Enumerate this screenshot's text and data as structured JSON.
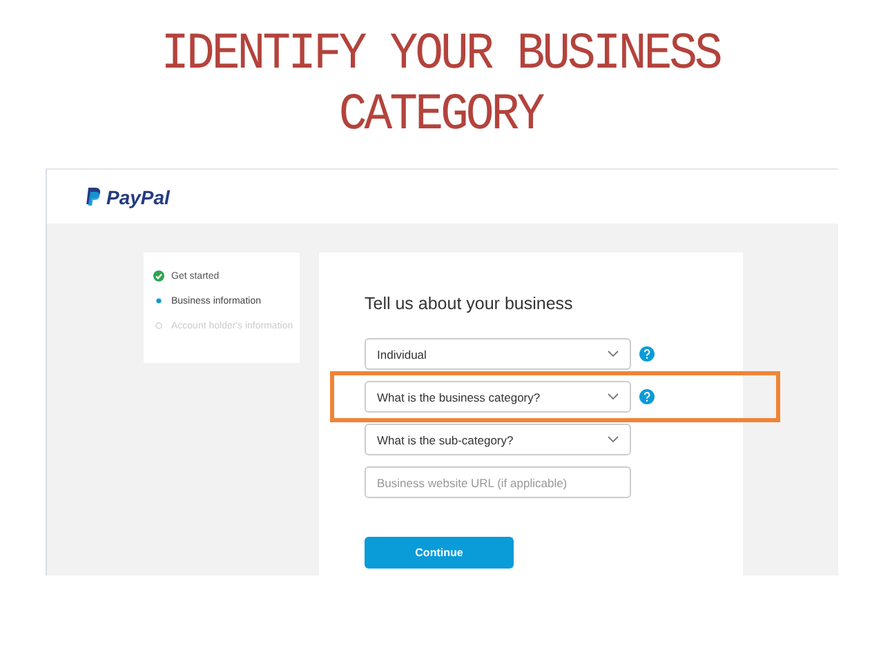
{
  "slide_title": [
    "IDENTIFY YOUR BUSINESS",
    "CATEGORY"
  ],
  "header": {
    "logo_text": "PayPal"
  },
  "steps": [
    {
      "label": "Get started",
      "completed": true,
      "current": false
    },
    {
      "label": "Business information",
      "completed": false,
      "current": true
    },
    {
      "label": "Account holder's information",
      "completed": false,
      "current": false
    }
  ],
  "form": {
    "heading": "Tell us about your business",
    "fields": [
      {
        "kind": "select",
        "value": "Individual",
        "help": true,
        "highlighted": false
      },
      {
        "kind": "select",
        "value": "What is the business category?",
        "help": true,
        "highlighted": true
      },
      {
        "kind": "select",
        "value": "What is the sub-category?",
        "help": false,
        "highlighted": false
      },
      {
        "kind": "text",
        "placeholder": "Business website URL (if applicable)",
        "help": false,
        "highlighted": false
      }
    ],
    "button": "Continue"
  }
}
